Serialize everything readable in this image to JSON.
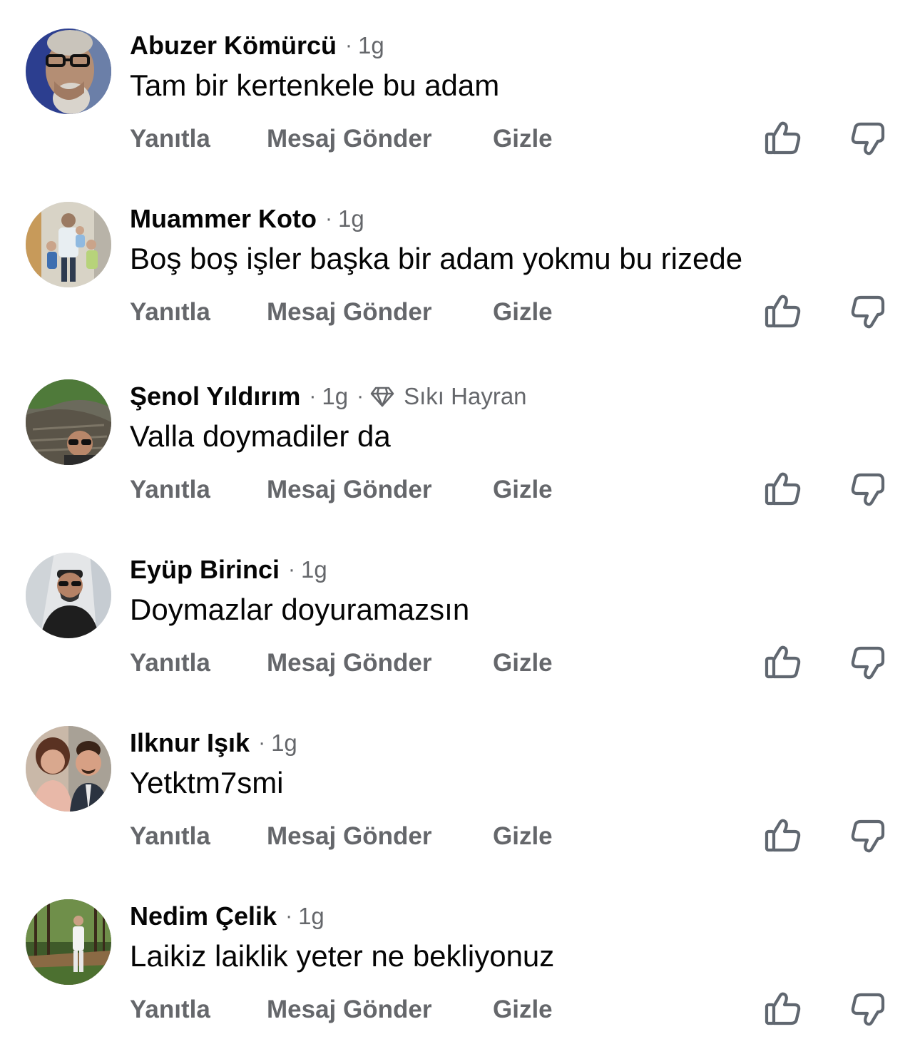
{
  "actions": {
    "reply_label": "Yanıtla",
    "message_label": "Mesaj Gönder",
    "hide_label": "Gizle"
  },
  "separator": "·",
  "comments": [
    {
      "author": "Abuzer Kömürcü",
      "time": "1g",
      "badge": "",
      "text": "Tam bir kertenkele bu adam",
      "avatar_icon": "avatar-man-glasses"
    },
    {
      "author": "Muammer Koto",
      "time": "1g",
      "badge": "",
      "text": "Boş boş işler başka bir adam yokmu bu rizede",
      "avatar_icon": "avatar-family"
    },
    {
      "author": "Şenol Yıldırım",
      "time": "1g",
      "badge": "Sıkı Hayran",
      "badge_icon": "diamond-icon",
      "text": "Valla doymadiler da",
      "avatar_icon": "avatar-outdoor"
    },
    {
      "author": "Eyüp Birinci",
      "time": "1g",
      "badge": "",
      "text": "Doymazlar doyuramazsın",
      "avatar_icon": "avatar-car-selfie"
    },
    {
      "author": "Ilknur Işık",
      "time": "1g",
      "badge": "",
      "text": "Yetktm7smi",
      "avatar_icon": "avatar-couple"
    },
    {
      "author": "Nedim Çelik",
      "time": "1g",
      "badge": "",
      "text": "Laikiz laiklik yeter ne bekliyonuz",
      "avatar_icon": "avatar-forest"
    }
  ],
  "colors": {
    "text_primary": "#050505",
    "text_secondary": "#65676b",
    "icon": "#606770",
    "background": "#ffffff"
  }
}
